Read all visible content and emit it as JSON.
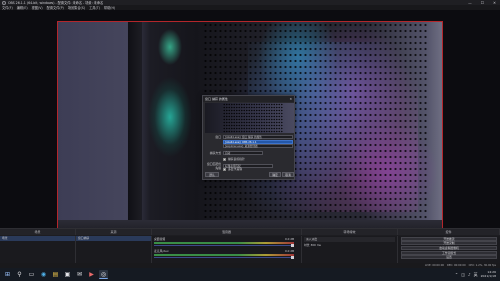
{
  "window": {
    "title": "OBS 26.1.1 (64-bit, windows) - 配置文件: 未命名 - 场景: 未命名",
    "controls": [
      "—",
      "☐",
      "✕"
    ]
  },
  "menu": [
    "文件(F)",
    "编辑(E)",
    "视图(V)",
    "配置文件(P)",
    "场景集合(S)",
    "工具(T)",
    "帮助(H)"
  ],
  "dialog": {
    "title": "窗口 捕获 的属性",
    "close": "✕",
    "window_label": "窗口",
    "window_value": "[obs64.exe]: 窗口 捕获 的属性",
    "options": [
      "[obs64.exe]: OBS 26.1.1",
      "[explorer.exe]: 资源管理器"
    ],
    "method_label": "捕获方式",
    "method_value": "自动",
    "priority_label": "窗口匹配优先级",
    "priority_value": "标题必须匹配",
    "capture_cursor": "捕获鼠标指针",
    "multi_adapter": "多显卡兼容",
    "btn_defaults": "默认",
    "btn_ok": "确定",
    "btn_cancel": "取消"
  },
  "docks": {
    "headers": [
      "场景",
      "来源",
      "混音器",
      "转场特效",
      "控件"
    ],
    "scenes": [
      "场景"
    ],
    "sources": [
      "窗口捕获"
    ],
    "mixer": [
      {
        "name": "桌面音频",
        "db": "0.0 dB",
        "level": 0.62
      },
      {
        "name": "麦克风/Aux",
        "db": "0.0 dB",
        "level": 0.35
      }
    ],
    "transitions": [
      "淡入淡出",
      "时长 300 ms"
    ],
    "controls": [
      "开始推流",
      "开始录制",
      "启动虚拟摄像机",
      "工作室模式",
      "设置",
      "退出"
    ]
  },
  "status": {
    "live": "LIVE: 00:00:00",
    "rec": "REC: 00:00:00",
    "cpu": "CPU: 1.2%, 30.00 fps"
  },
  "taskbar": {
    "icons": [
      "windows-start-icon",
      "search-icon",
      "task-view-icon",
      "edge-icon",
      "file-explorer-icon",
      "store-icon",
      "mail-icon",
      "media-icon",
      "obs-icon"
    ],
    "glyphs": [
      "⊞",
      "⚲",
      "▭",
      "◉",
      "▤",
      "▣",
      "✉",
      "▶",
      "◎"
    ],
    "tray_glyphs": [
      "⌃",
      "◫",
      "♪",
      "英"
    ],
    "time": "14:26",
    "date": "2021/1/18"
  }
}
